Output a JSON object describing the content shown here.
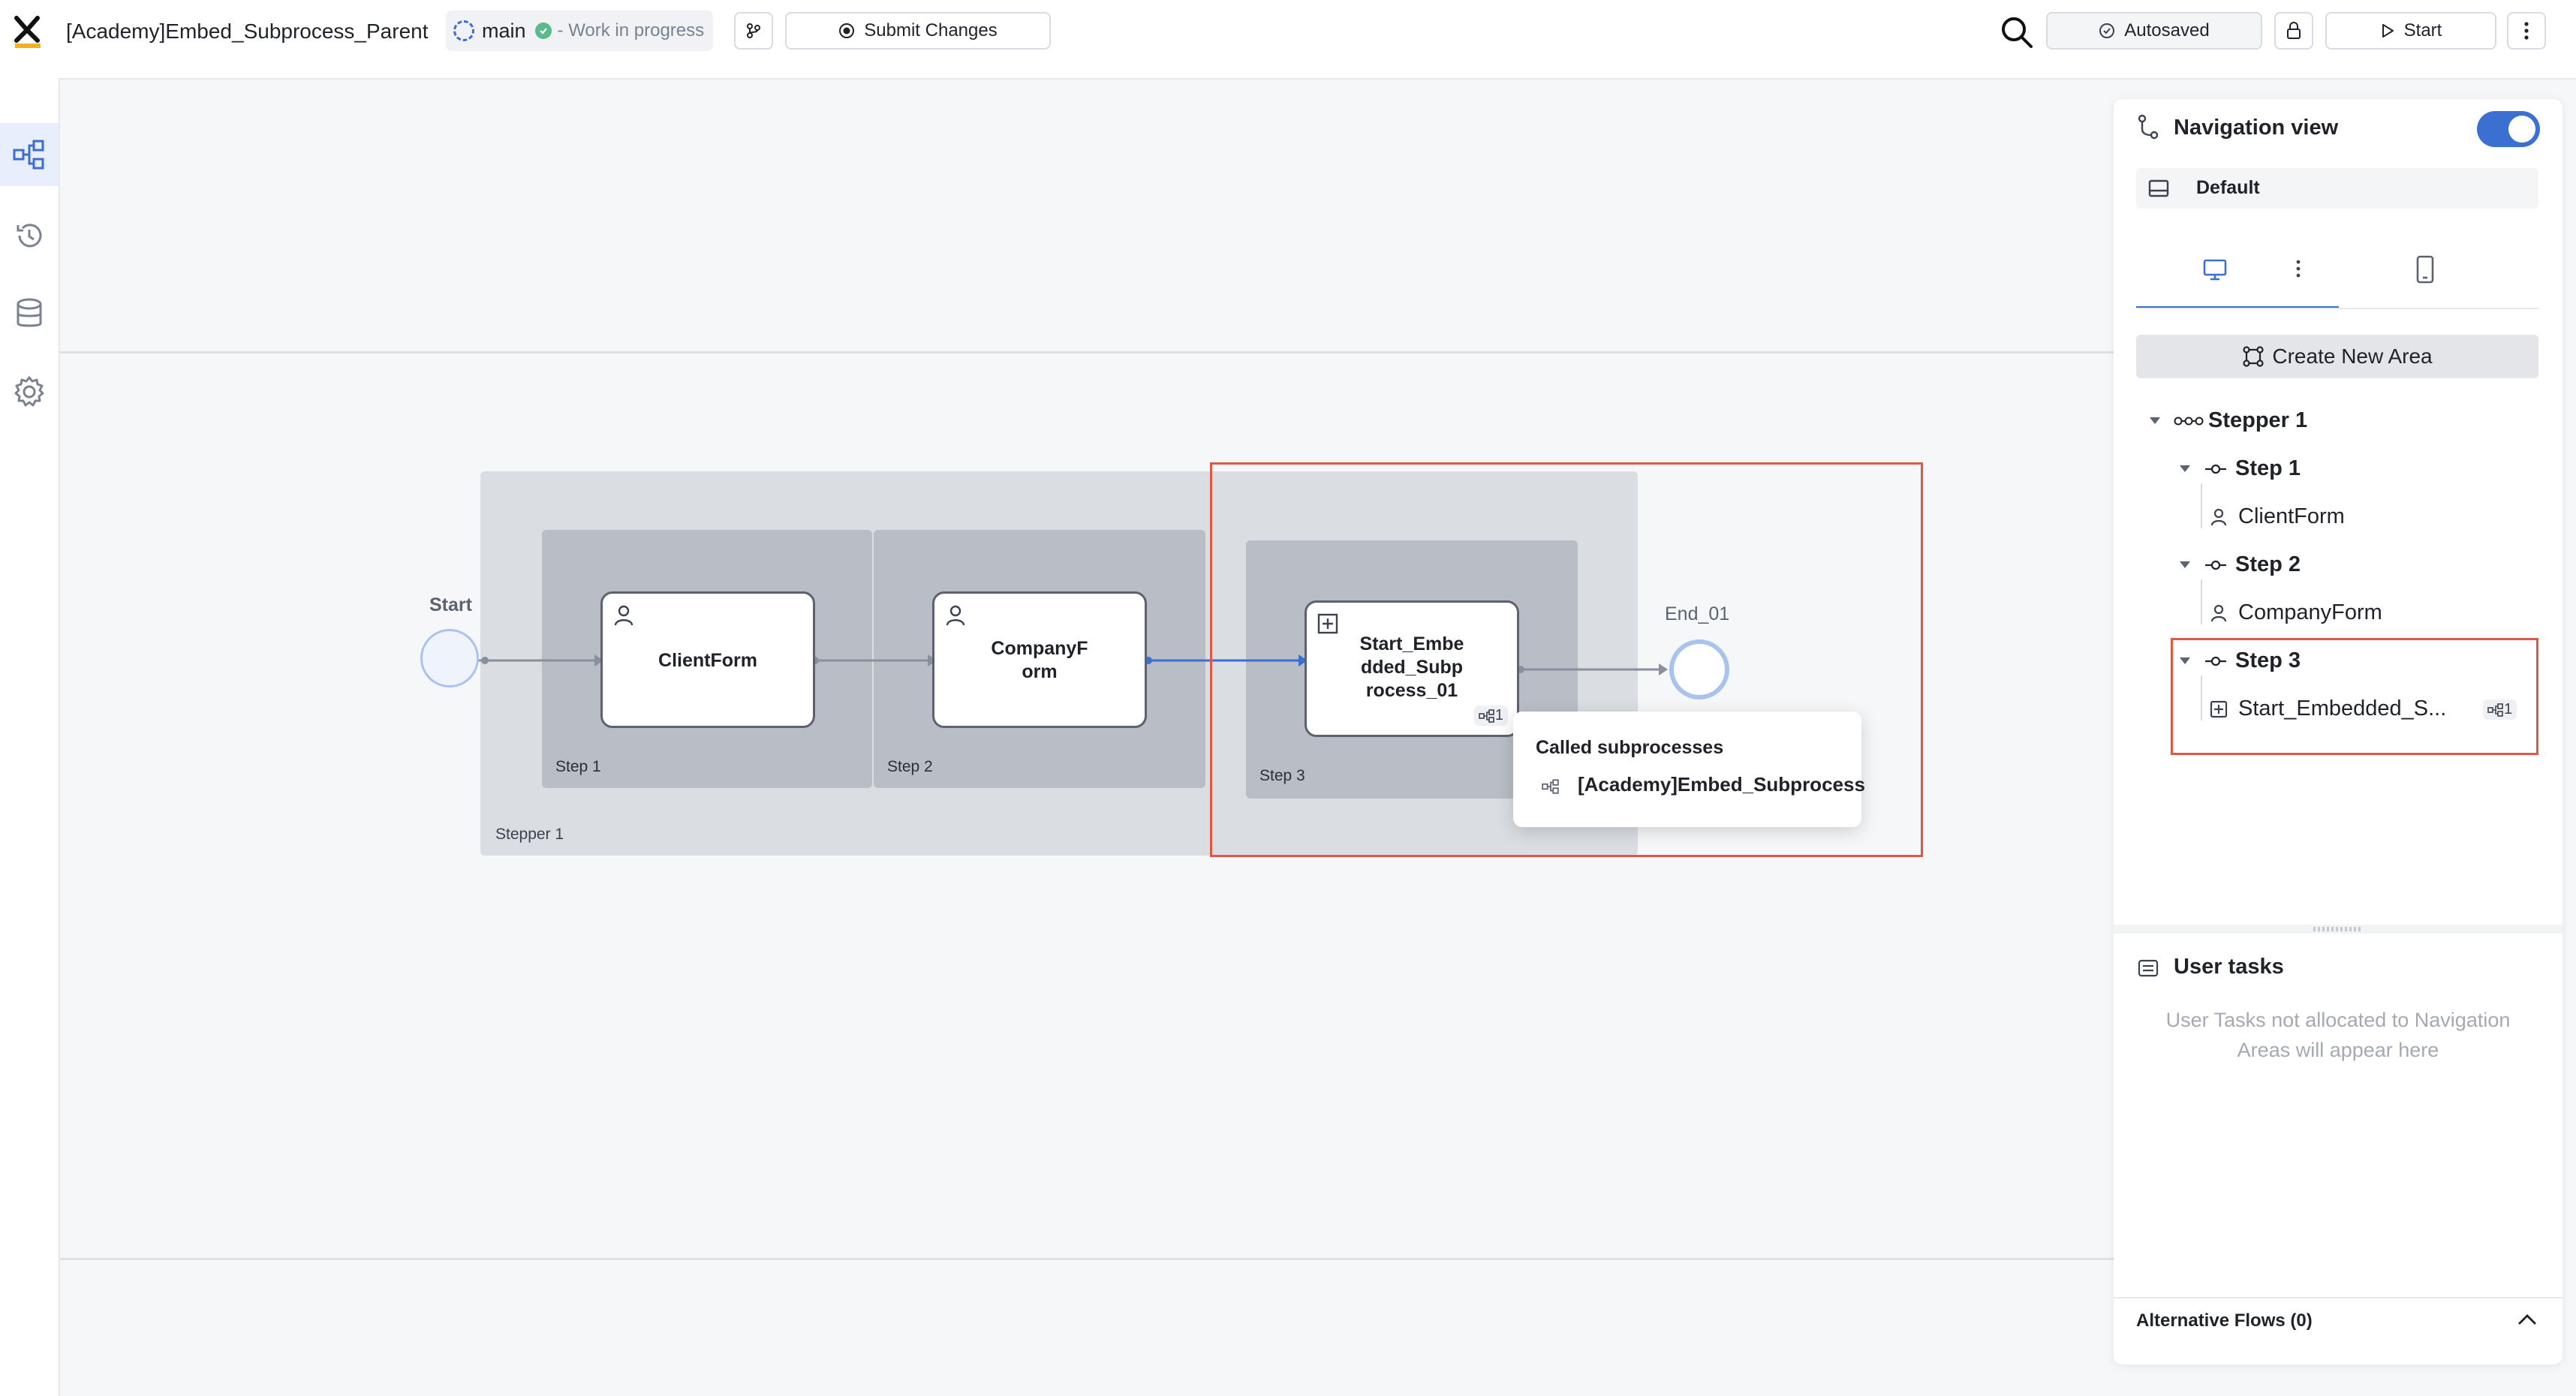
{
  "header": {
    "title": "[Academy]Embed_Subprocess_Parent",
    "branch": "main",
    "branch_status": "- Work in progress",
    "submit_label": "Submit Changes",
    "autosave_label": "Autosaved",
    "start_label": "Start"
  },
  "sidebar": {
    "items": [
      {
        "icon": "process-map-icon",
        "active": true
      },
      {
        "icon": "history-icon",
        "active": false
      },
      {
        "icon": "database-icon",
        "active": false
      },
      {
        "icon": "settings-gear-icon",
        "active": false
      }
    ]
  },
  "diagram": {
    "start_label": "Start",
    "end_label": "End_01",
    "stepper_label": "Stepper 1",
    "step1_label": "Step 1",
    "step2_label": "Step 2",
    "step3_label": "Step 3",
    "node1_label": "ClientForm",
    "node2_line1": "CompanyF",
    "node2_line2": "orm",
    "node3_line1": "Start_Embe",
    "node3_line2": "dded_Subp",
    "node3_line3": "rocess_01",
    "node3_badge": "1",
    "tooltip_title": "Called subprocesses",
    "tooltip_item": "[Academy]Embed_Subprocess"
  },
  "panel": {
    "title": "Navigation view",
    "toggle_on": true,
    "config_label": "Default",
    "create_area_label": "Create New Area",
    "tree": {
      "stepper": "Stepper 1",
      "step1": "Step 1",
      "step1_task": "ClientForm",
      "step2": "Step 2",
      "step2_task": "CompanyForm",
      "step3": "Step 3",
      "step3_task": "Start_Embedded_S...",
      "step3_badge": "1"
    },
    "user_tasks_title": "User tasks",
    "user_tasks_empty_1": "User Tasks not allocated to Navigation",
    "user_tasks_empty_2": "Areas will appear here",
    "alt_flows_label": "Alternative Flows (0)"
  },
  "colors": {
    "accent": "#3b6fd1",
    "highlight": "#e6553f",
    "stepper_bg": "#dadde2",
    "step_bg": "#b9bdc5"
  }
}
